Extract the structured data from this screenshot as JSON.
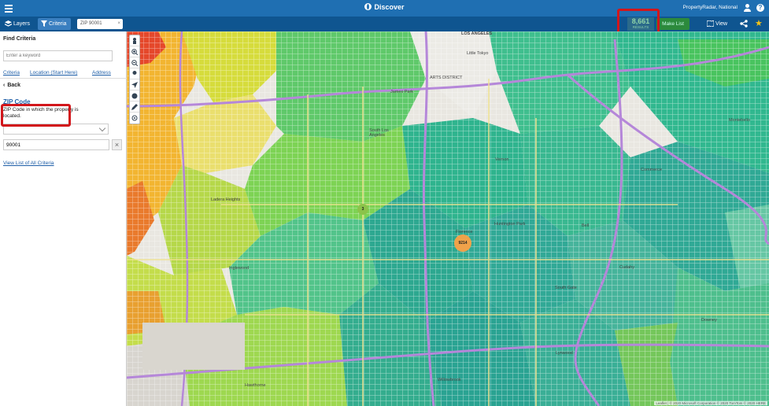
{
  "header": {
    "title": "Discover",
    "account": "PropertyRadar, National"
  },
  "toolbar": {
    "layers_label": "Layers",
    "criteria_label": "Criteria",
    "filter_chip": "ZIP 90001",
    "result_count": "8,661",
    "result_count_label": "RESULTS",
    "make_list_label": "Make List",
    "view_label": "View"
  },
  "panel": {
    "title": "Find Criteria",
    "search_placeholder": "Enter a keyword",
    "tabs": [
      "Criteria",
      "Location (Start Here)",
      "Address"
    ],
    "back_label": "Back",
    "criterion_title": "ZIP Code",
    "criterion_desc": "ZIP Code in which the property is located.",
    "operator_value": "",
    "zip_value": "90001",
    "view_all_link": "View List of All Criteria"
  },
  "map": {
    "clusters": [
      {
        "label": "3",
        "color": "#8bc34a"
      },
      {
        "label": "9214",
        "color": "#f0a24a"
      }
    ],
    "labels": {
      "los_angeles": "LOS ANGELES",
      "little_tokyo": "Little Tokyo",
      "arts_district": "ARTS DISTRICT",
      "james_park": "James Park",
      "south_los_angeles": "South Los Angeles",
      "vernon": "Vernon",
      "commerce": "Commerce",
      "huntington_park": "Huntington Park",
      "bell": "Bell",
      "cudahy": "Cudahy",
      "south_gate": "South Gate",
      "inglewood": "Inglewood",
      "ladera_heights": "Ladera Heights",
      "hawthorne": "Hawthorne",
      "lynwood": "Lynwood",
      "willowbrook": "Willowbrook",
      "downey": "Downey",
      "montebello": "Montebello",
      "florence": "Florence"
    },
    "attribution": "Leaflet | © 2020 Microsoft Corporation © 2020 TomTom © 2020 HERE"
  },
  "colors": {
    "header": "#1f6fb2",
    "toolbar": "#0f5590",
    "highlight": "#d2161b",
    "make_list": "#2c8a3c"
  }
}
